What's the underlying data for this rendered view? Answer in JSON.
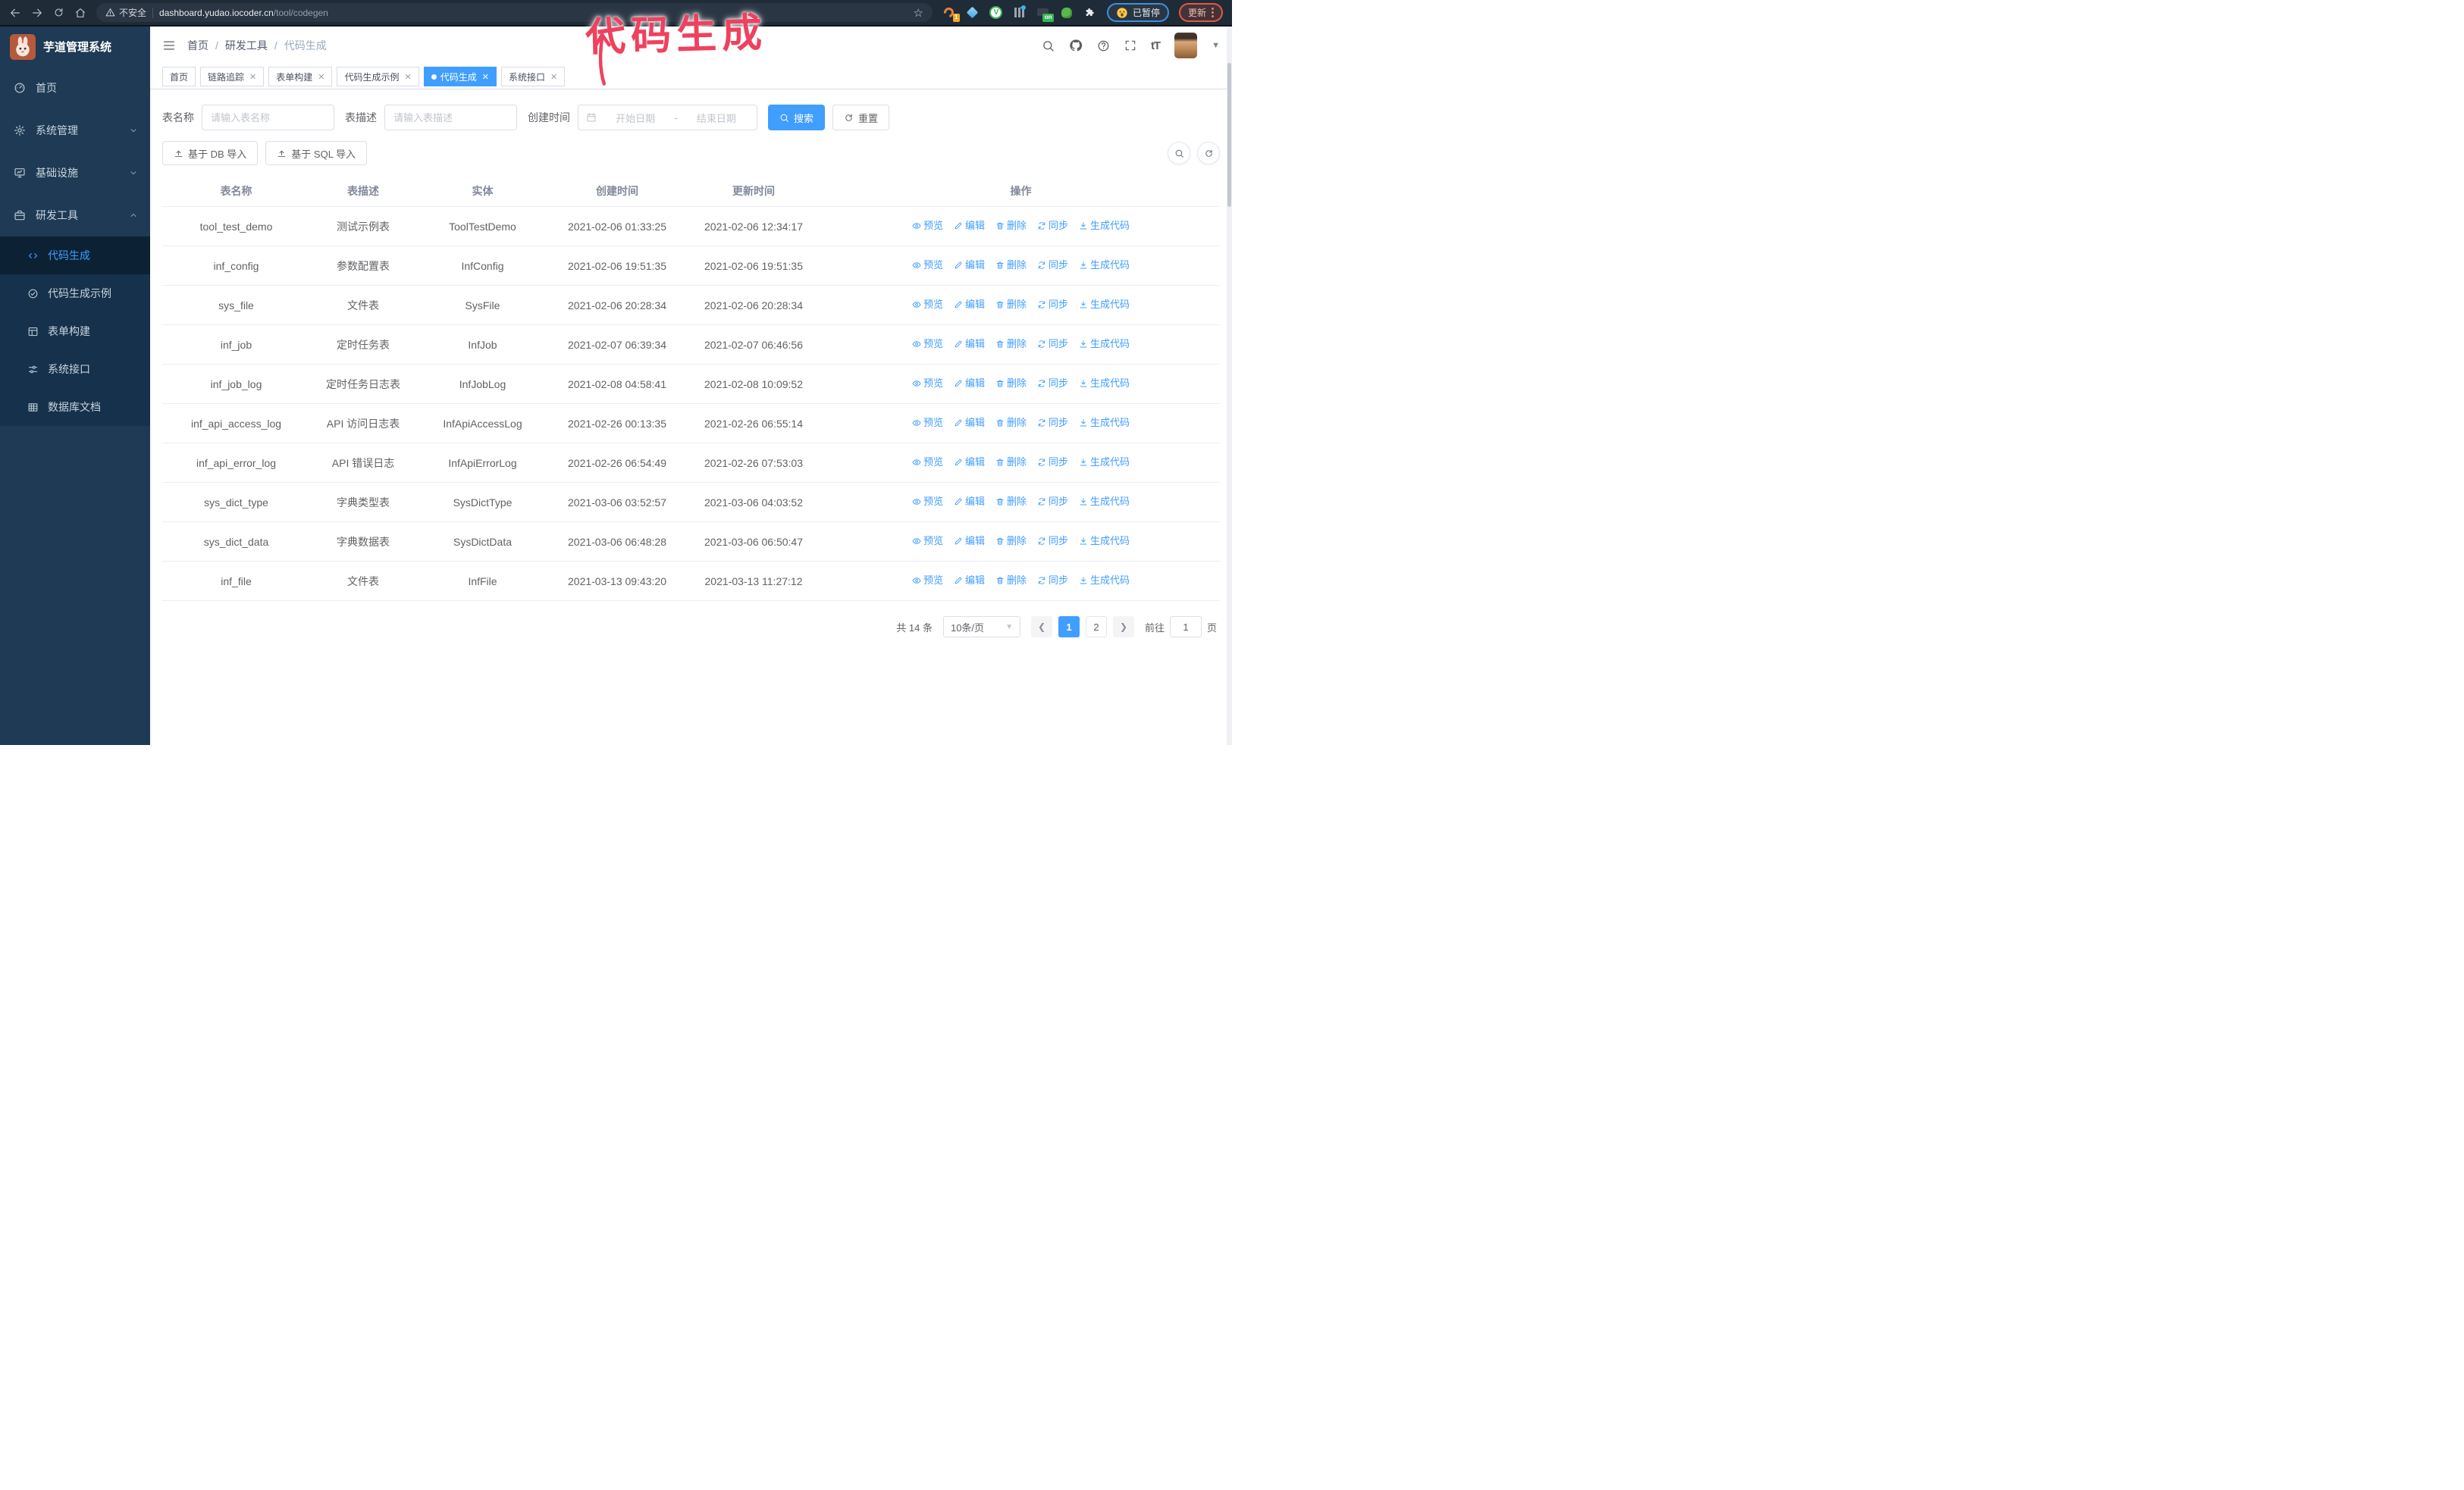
{
  "browser": {
    "security_label": "不安全",
    "url_domain": "dashboard.yudao.iocoder.cn",
    "url_path": "/tool/codegen",
    "paused_label": "已暂停",
    "update_label": "更新",
    "extensions": [
      {
        "icon": "orange-ring-extension-icon",
        "badge": "1"
      },
      {
        "icon": "blue-gem-extension-icon"
      },
      {
        "icon": "green-v-extension-icon",
        "letter": "V"
      },
      {
        "icon": "columns-extension-icon"
      },
      {
        "icon": "dark-on-extension-icon",
        "badge": "on"
      },
      {
        "icon": "green-creature-extension-icon"
      },
      {
        "icon": "puzzle-extension-icon"
      }
    ]
  },
  "annotation": {
    "text": "代码生成"
  },
  "sidebar": {
    "title": "芋道管理系统",
    "items": [
      {
        "label": "首页",
        "icon": "dashboard-icon"
      },
      {
        "label": "系统管理",
        "icon": "gear-icon",
        "chevron": "down"
      },
      {
        "label": "基础设施",
        "icon": "monitor-icon",
        "chevron": "down"
      },
      {
        "label": "研发工具",
        "icon": "toolbox-icon",
        "chevron": "up",
        "expanded": true
      }
    ],
    "subitems": [
      {
        "label": "代码生成",
        "icon": "code-icon",
        "active": true
      },
      {
        "label": "代码生成示例",
        "icon": "check-circle-icon"
      },
      {
        "label": "表单构建",
        "icon": "form-icon"
      },
      {
        "label": "系统接口",
        "icon": "sliders-icon"
      },
      {
        "label": "数据库文档",
        "icon": "db-table-icon"
      }
    ]
  },
  "header": {
    "breadcrumb": [
      "首页",
      "研发工具",
      "代码生成"
    ],
    "font_size_label": "tT"
  },
  "tabs": [
    {
      "label": "首页",
      "closable": false,
      "active": false
    },
    {
      "label": "链路追踪",
      "closable": true,
      "active": false
    },
    {
      "label": "表单构建",
      "closable": true,
      "active": false
    },
    {
      "label": "代码生成示例",
      "closable": true,
      "active": false
    },
    {
      "label": "代码生成",
      "closable": true,
      "active": true
    },
    {
      "label": "系统接口",
      "closable": true,
      "active": false
    }
  ],
  "filters": {
    "table_name_label": "表名称",
    "table_name_placeholder": "请输入表名称",
    "table_desc_label": "表描述",
    "table_desc_placeholder": "请输入表描述",
    "create_time_label": "创建时间",
    "date_start_placeholder": "开始日期",
    "date_separator": "-",
    "date_end_placeholder": "结束日期",
    "search_button": "搜索",
    "reset_button": "重置"
  },
  "toolbar": {
    "import_db": "基于 DB 导入",
    "import_sql": "基于 SQL 导入"
  },
  "table": {
    "columns": [
      "表名称",
      "表描述",
      "实体",
      "创建时间",
      "更新时间",
      "操作"
    ],
    "actions": [
      {
        "label": "预览",
        "icon": "eye-icon"
      },
      {
        "label": "编辑",
        "icon": "edit-icon"
      },
      {
        "label": "删除",
        "icon": "delete-icon"
      },
      {
        "label": "同步",
        "icon": "sync-icon"
      },
      {
        "label": "生成代码",
        "icon": "download-icon"
      }
    ],
    "rows": [
      {
        "name": "tool_test_demo",
        "desc": "测试示例表",
        "entity": "ToolTestDemo",
        "created": "2021-02-06 01:33:25",
        "updated": "2021-02-06 12:34:17"
      },
      {
        "name": "inf_config",
        "desc": "参数配置表",
        "entity": "InfConfig",
        "created": "2021-02-06 19:51:35",
        "updated": "2021-02-06 19:51:35"
      },
      {
        "name": "sys_file",
        "desc": "文件表",
        "entity": "SysFile",
        "created": "2021-02-06 20:28:34",
        "updated": "2021-02-06 20:28:34"
      },
      {
        "name": "inf_job",
        "desc": "定时任务表",
        "entity": "InfJob",
        "created": "2021-02-07 06:39:34",
        "updated": "2021-02-07 06:46:56"
      },
      {
        "name": "inf_job_log",
        "desc": "定时任务日志表",
        "entity": "InfJobLog",
        "created": "2021-02-08 04:58:41",
        "updated": "2021-02-08 10:09:52"
      },
      {
        "name": "inf_api_access_log",
        "desc": "API 访问日志表",
        "entity": "InfApiAccessLog",
        "created": "2021-02-26 00:13:35",
        "updated": "2021-02-26 06:55:14"
      },
      {
        "name": "inf_api_error_log",
        "desc": "API 错误日志",
        "entity": "InfApiErrorLog",
        "created": "2021-02-26 06:54:49",
        "updated": "2021-02-26 07:53:03"
      },
      {
        "name": "sys_dict_type",
        "desc": "字典类型表",
        "entity": "SysDictType",
        "created": "2021-03-06 03:52:57",
        "updated": "2021-03-06 04:03:52"
      },
      {
        "name": "sys_dict_data",
        "desc": "字典数据表",
        "entity": "SysDictData",
        "created": "2021-03-06 06:48:28",
        "updated": "2021-03-06 06:50:47"
      },
      {
        "name": "inf_file",
        "desc": "文件表",
        "entity": "InfFile",
        "created": "2021-03-13 09:43:20",
        "updated": "2021-03-13 11:27:12"
      }
    ]
  },
  "pagination": {
    "total": "共 14 条",
    "page_size": "10条/页",
    "pages": [
      "1",
      "2"
    ],
    "active_page": "1",
    "goto_label": "前往",
    "goto_value": "1",
    "goto_suffix": "页"
  },
  "colors": {
    "accent": "#409eff",
    "chrome_bg": "#202b38",
    "sidebar_bg": "#1e3a54",
    "submenu_bg": "#16314b",
    "active_item_bg": "#0d2134",
    "annotation": "#ef415e"
  }
}
